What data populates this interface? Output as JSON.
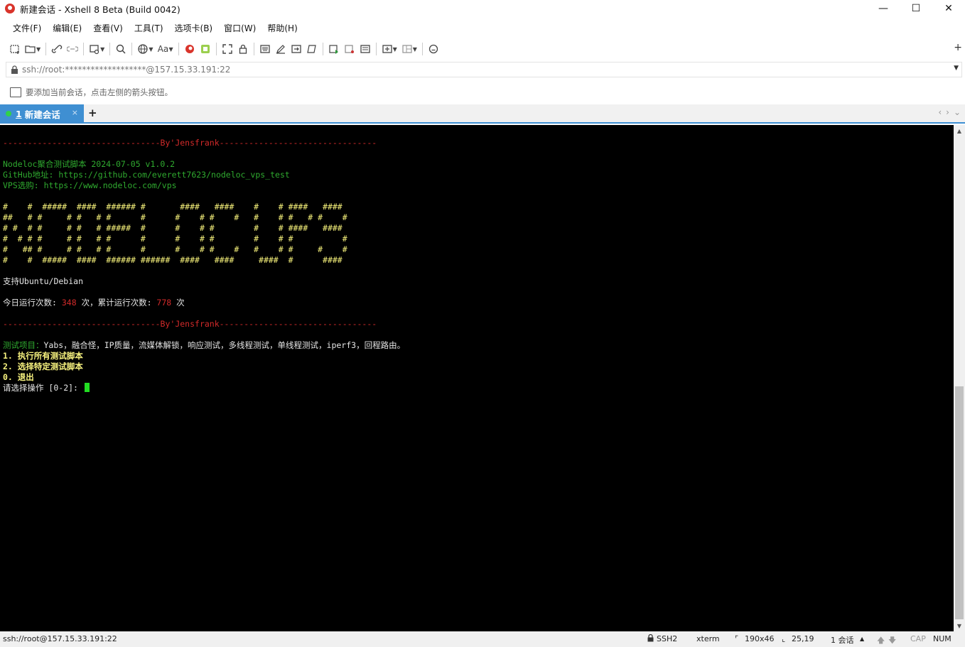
{
  "window": {
    "title": "新建会话 - Xshell 8 Beta (Build 0042)",
    "minimize": "—",
    "maximize": "☐",
    "close": "✕"
  },
  "menu": [
    "文件(F)",
    "编辑(E)",
    "查看(V)",
    "工具(T)",
    "选项卡(B)",
    "窗口(W)",
    "帮助(H)"
  ],
  "toolbar": {
    "plus": "+"
  },
  "address": {
    "value": "ssh://root:*******************@157.15.33.191:22"
  },
  "hint": {
    "text": "要添加当前会话，点击左侧的箭头按钮。"
  },
  "tabs": {
    "active_number": "1",
    "active_label": "新建会话",
    "close": "×",
    "add": "+",
    "prev": "‹",
    "next": "›",
    "menu": "⌄"
  },
  "terminal": {
    "sep_top": "--------------------------------By'Jensfrank--------------------------------",
    "info1": "Nodeloc聚合测试脚本 2024-07-05 v1.0.2",
    "info2": "GitHub地址: https://github.com/everett7623/nodeloc_vps_test",
    "info3": "VPS选购: https://www.nodeloc.com/vps",
    "art1": "#    #  #####  ####  ###### #       ####   ####    #    # ####   ####",
    "art2": "##   # #     # #   # #      #      #    # #    #   #    # #   # #    #",
    "art3": "# #  # #     # #   # #####  #      #    # #        #    # ####   ####",
    "art4": "#  # # #     # #   # #      #      #    # #        #    # #          #",
    "art5": "#   ## #     # #   # #      #      #    # #    #   #    # #     #    #",
    "art6": "#    #  #####  ####  ###### ######  ####   ####     ####  #      ####",
    "support": "支持Ubuntu/Debian",
    "count_prefix": "今日运行次数: ",
    "count_today": "348",
    "count_mid": " 次，累计运行次数: ",
    "count_total": "778",
    "count_suffix": " 次",
    "sep_bottom": "--------------------------------By'Jensfrank--------------------------------",
    "items_label": "测试项目：",
    "items_text": "Yabs，融合怪，IP质量，流媒体解锁，响应测试，多线程测试，单线程测试，iperf3，回程路由。",
    "opt1": "1. 执行所有测试脚本",
    "opt2": "2. 选择特定测试脚本",
    "opt0": "0. 退出",
    "prompt": "请选择操作 [0-2]: "
  },
  "status": {
    "connection": "ssh://root@157.15.33.191:22",
    "protocol": "SSH2",
    "term": "xterm",
    "size": "190x46",
    "cursor_pos": "25,19",
    "sessions": "1 会话",
    "cap": "CAP",
    "num": "NUM"
  },
  "colors": {
    "tab_active": "#3f8fd2",
    "terminal_bg": "#000000",
    "red": "#d22a2a",
    "green": "#2faa2f",
    "yellow": "#f6f17a",
    "cursor": "#22dd22"
  }
}
